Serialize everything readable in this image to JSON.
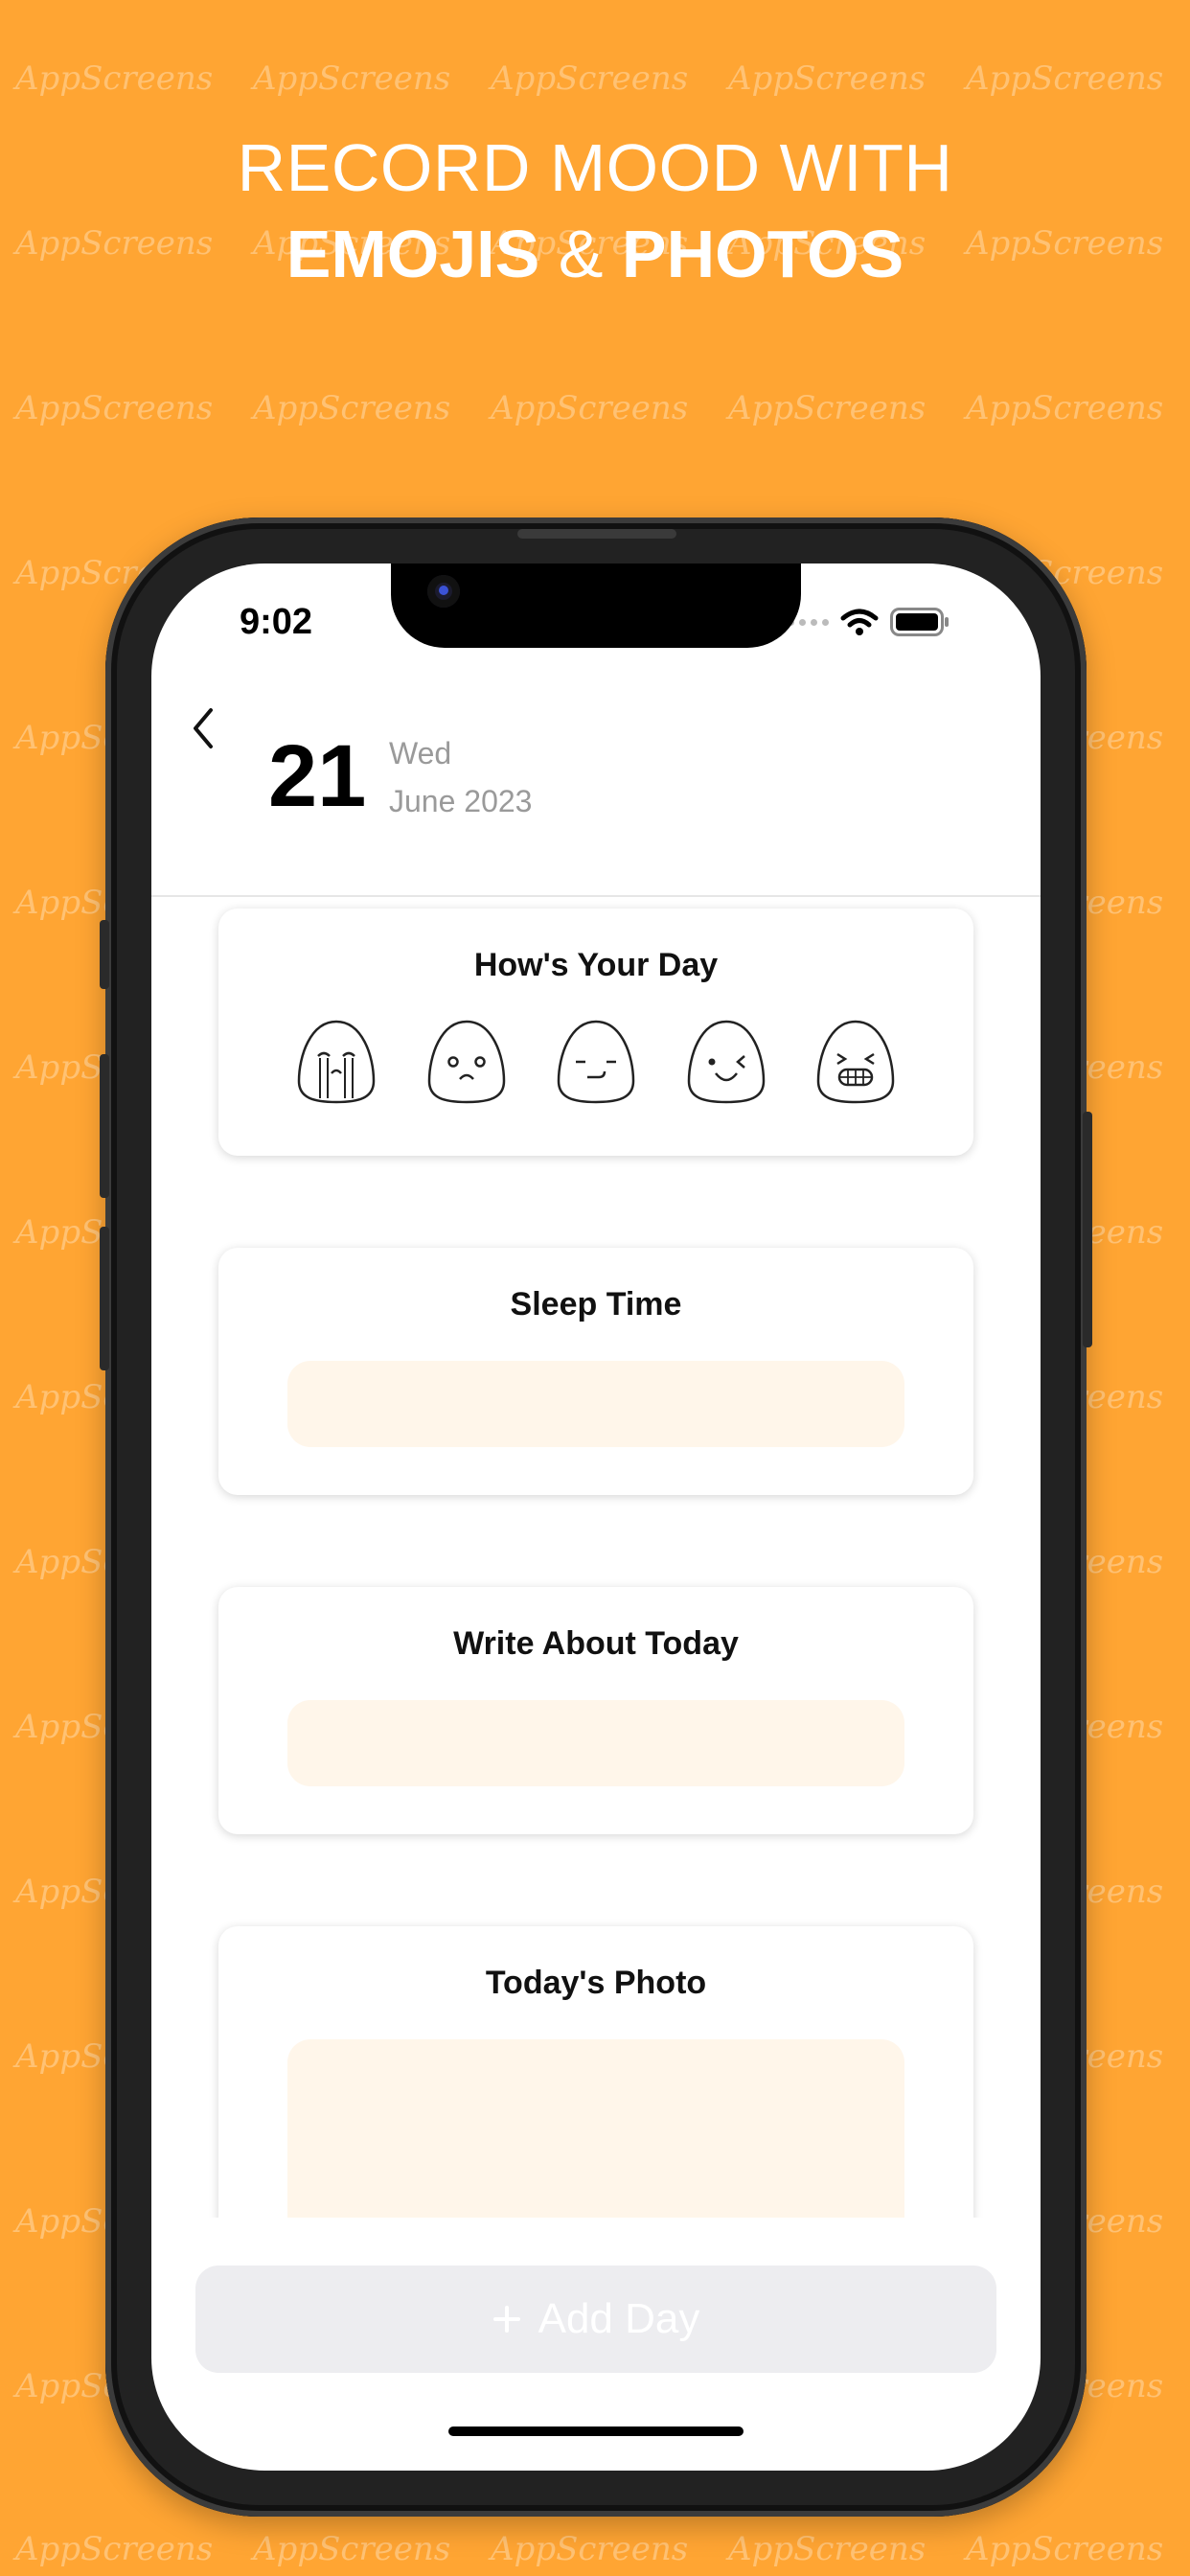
{
  "watermark": "AppScreens",
  "headline": {
    "line1": "RECORD MOOD WITH",
    "line2_part1": "EMOJIS",
    "line2_amp": "&",
    "line2_part2": "PHOTOS"
  },
  "status_bar": {
    "time": "9:02",
    "icons": [
      "signal-dots-icon",
      "wifi-icon",
      "battery-icon"
    ]
  },
  "header": {
    "back_icon": "chevron-left-icon",
    "day": "21",
    "weekday": "Wed",
    "month_year": "June 2023"
  },
  "cards": {
    "mood": {
      "title": "How's Your Day",
      "emojis": [
        "crying-face",
        "sad-face",
        "neutral-face",
        "wink-face",
        "grin-face"
      ]
    },
    "sleep": {
      "title": "Sleep Time"
    },
    "write": {
      "title": "Write About Today"
    },
    "photo": {
      "title": "Today's Photo"
    }
  },
  "add_day": {
    "icon": "plus-icon",
    "label": "Add Day"
  },
  "colors": {
    "background": "#FFA533",
    "field": "#FFF6EA",
    "button": "#EDEDF0"
  }
}
